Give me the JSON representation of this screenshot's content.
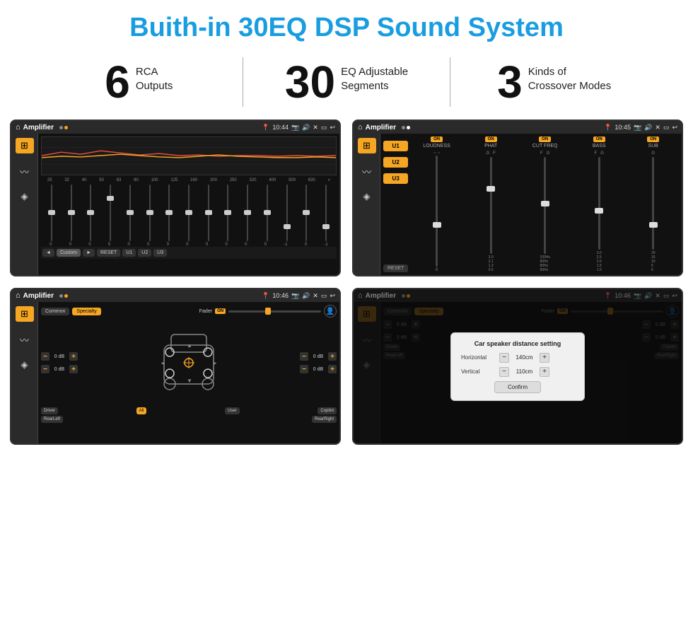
{
  "header": {
    "title": "Buith-in 30EQ DSP Sound System"
  },
  "stats": [
    {
      "number": "6",
      "line1": "RCA",
      "line2": "Outputs"
    },
    {
      "number": "30",
      "line1": "EQ Adjustable",
      "line2": "Segments"
    },
    {
      "number": "3",
      "line1": "Kinds of",
      "line2": "Crossover Modes"
    }
  ],
  "screens": [
    {
      "id": "eq-screen",
      "statusBar": {
        "title": "Amplifier",
        "time": "10:44"
      },
      "type": "eq"
    },
    {
      "id": "crossover-screen",
      "statusBar": {
        "title": "Amplifier",
        "time": "10:45"
      },
      "type": "crossover"
    },
    {
      "id": "speaker-screen",
      "statusBar": {
        "title": "Amplifier",
        "time": "10:46"
      },
      "type": "speaker"
    },
    {
      "id": "dialog-screen",
      "statusBar": {
        "title": "Amplifier",
        "time": "10:46"
      },
      "type": "dialog"
    }
  ],
  "eq": {
    "frequencies": [
      "25",
      "32",
      "40",
      "50",
      "63",
      "80",
      "100",
      "125",
      "160",
      "200",
      "250",
      "320",
      "400",
      "500",
      "630"
    ],
    "values": [
      "0",
      "0",
      "0",
      "5",
      "0",
      "0",
      "0",
      "0",
      "0",
      "0",
      "0",
      "0",
      "-1",
      "0",
      "-1"
    ],
    "preset": "Custom",
    "buttons": [
      "◄",
      "Custom",
      "►",
      "RESET",
      "U1",
      "U2",
      "U3"
    ]
  },
  "crossover": {
    "uButtons": [
      "U1",
      "U2",
      "U3"
    ],
    "channels": [
      "LOUDNESS",
      "PHAT",
      "CUT FREQ",
      "BASS",
      "SUB"
    ],
    "resetLabel": "RESET"
  },
  "speaker": {
    "tabs": [
      "Common",
      "Specialty"
    ],
    "faderLabel": "Fader",
    "faderOnLabel": "ON",
    "leftDb": "0 dB",
    "rightDb": "0 dB",
    "bottomLeftDb": "0 dB",
    "bottomRightDb": "0 dB",
    "buttons": [
      "Driver",
      "",
      "Copilot",
      "RearLeft",
      "All",
      "User",
      "RearRight"
    ]
  },
  "dialog": {
    "title": "Car speaker distance setting",
    "horizontalLabel": "Horizontal",
    "horizontalValue": "140cm",
    "verticalLabel": "Vertical",
    "verticalValue": "110cm",
    "confirmLabel": "Confirm"
  }
}
